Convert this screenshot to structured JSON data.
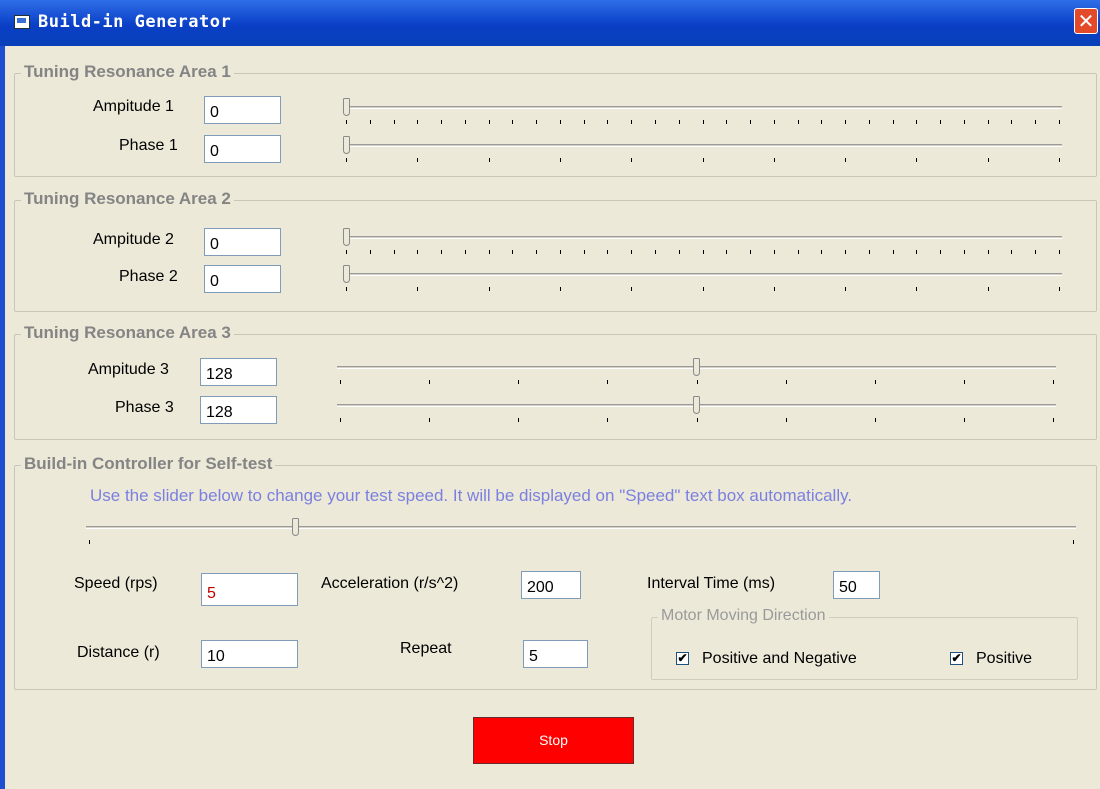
{
  "window": {
    "title": "Build-in Generator",
    "close_glyph": "✕"
  },
  "areas": [
    {
      "title": "Tuning Resonance Area 1",
      "amp_label": "Ampitude 1",
      "amp_value": "0",
      "phase_label": "Phase 1",
      "phase_value": "0",
      "amp_slider": 0.0,
      "phase_slider": 0.0
    },
    {
      "title": "Tuning Resonance Area 2",
      "amp_label": "Ampitude 2",
      "amp_value": "0",
      "phase_label": "Phase 2",
      "phase_value": "0",
      "amp_slider": 0.0,
      "phase_slider": 0.0
    },
    {
      "title": "Tuning Resonance Area 3",
      "amp_label": "Ampitude 3",
      "amp_value": "128",
      "phase_label": "Phase 3",
      "phase_value": "128",
      "amp_slider": 0.5,
      "phase_slider": 0.5
    }
  ],
  "controller": {
    "title": "Build-in Controller for Self-test",
    "hint": "Use the slider below to change your test speed. It will be displayed on \"Speed\" text box automatically.",
    "speed_slider": 0.21,
    "speed_label": "Speed (rps)",
    "speed_value": "5",
    "accel_label": "Acceleration (r/s^2)",
    "accel_value": "200",
    "interval_label": "Interval Time (ms)",
    "interval_value": "50",
    "distance_label": "Distance (r)",
    "distance_value": "10",
    "repeat_label": "Repeat",
    "repeat_value": "5",
    "direction": {
      "title": "Motor Moving Direction",
      "pos_neg_label": "Positive and Negative",
      "pos_neg_checked": true,
      "pos_label": "Positive",
      "pos_checked": true
    }
  },
  "stop_button": {
    "label": "Stop",
    "color": "#ff0000"
  },
  "icons": {
    "window": "window-icon",
    "close": "close-icon",
    "check": "checkmark-icon"
  }
}
